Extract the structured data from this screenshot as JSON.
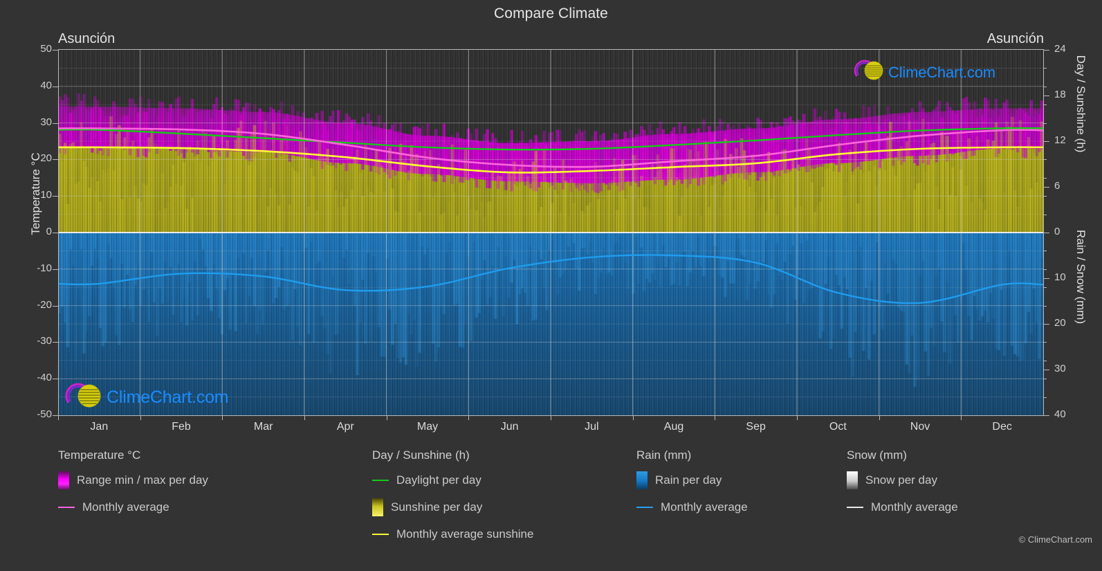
{
  "header": {
    "title": "Compare Climate"
  },
  "locations": {
    "left": "Asunción",
    "right": "Asunción"
  },
  "axes": {
    "left_title": "Temperature °C",
    "right_title_top": "Day / Sunshine (h)",
    "right_title_bottom": "Rain / Snow (mm)",
    "left_ticks": [
      "50",
      "40",
      "30",
      "20",
      "10",
      "0",
      "-10",
      "-20",
      "-30",
      "-40",
      "-50"
    ],
    "right_ticks_top": [
      "24",
      "18",
      "12",
      "6",
      "0"
    ],
    "right_ticks_bottom": [
      "0",
      "10",
      "20",
      "30",
      "40"
    ],
    "x_ticks": [
      "Jan",
      "Feb",
      "Mar",
      "Apr",
      "May",
      "Jun",
      "Jul",
      "Aug",
      "Sep",
      "Oct",
      "Nov",
      "Dec"
    ]
  },
  "logo": {
    "text": "ClimeChart.com",
    "arc_color": "#cc22cc",
    "sphere_color": "#d8d000",
    "text_color": "#1a8cff"
  },
  "legend": {
    "groups": [
      {
        "title": "Temperature °C",
        "items": [
          {
            "label": "Range min / max per day",
            "marker": "swatch",
            "color": "#ee00ee"
          },
          {
            "label": "Monthly average",
            "marker": "line",
            "color": "#ff66dd"
          }
        ]
      },
      {
        "title": "Day / Sunshine (h)",
        "items": [
          {
            "label": "Daylight per day",
            "marker": "line",
            "color": "#18c818"
          },
          {
            "label": "Sunshine per day",
            "marker": "swatch",
            "color": "#f2ef55"
          },
          {
            "label": "Monthly average sunshine",
            "marker": "line",
            "color": "#ffff33"
          }
        ]
      },
      {
        "title": "Rain (mm)",
        "items": [
          {
            "label": "Rain per day",
            "marker": "swatch",
            "color": "#1787d8"
          },
          {
            "label": "Monthly average",
            "marker": "line",
            "color": "#22a0ee"
          }
        ]
      },
      {
        "title": "Snow (mm)",
        "items": [
          {
            "label": "Snow per day",
            "marker": "swatch",
            "color": "#f2f2f2"
          },
          {
            "label": "Monthly average",
            "marker": "line",
            "color": "#e8e8e8"
          }
        ]
      }
    ]
  },
  "footer": {
    "copyright": "© ClimeChart.com"
  },
  "chart_data": {
    "type": "area",
    "title": "Compare Climate",
    "subtitle": "Asunción",
    "xlabel": "",
    "ylabel": "Temperature °C",
    "ylabel_right_top": "Day / Sunshine (h)",
    "ylabel_right_bottom": "Rain / Snow (mm)",
    "ylim": [
      -50,
      50
    ],
    "ylim_right_top": [
      0,
      24
    ],
    "ylim_right_bottom": [
      40,
      0
    ],
    "grid": true,
    "legend_position": "below",
    "categories": [
      "Jan",
      "Feb",
      "Mar",
      "Apr",
      "May",
      "Jun",
      "Jul",
      "Aug",
      "Sep",
      "Oct",
      "Nov",
      "Dec"
    ],
    "series": [
      {
        "name": "Range min / max per day",
        "unit": "°C",
        "type": "band",
        "color": "#ee00ee",
        "max_values": [
          34.5,
          34.0,
          33.0,
          30.0,
          26.5,
          24.5,
          25.0,
          27.0,
          28.5,
          31.0,
          33.0,
          34.0
        ],
        "min_values": [
          23.5,
          23.0,
          22.0,
          19.0,
          16.0,
          14.0,
          13.5,
          14.5,
          16.5,
          19.0,
          21.0,
          23.0
        ]
      },
      {
        "name": "Monthly average temperature",
        "unit": "°C",
        "type": "line",
        "color": "#ff66dd",
        "values": [
          28.5,
          28.2,
          27.0,
          24.0,
          20.5,
          18.5,
          18.0,
          19.5,
          21.0,
          24.0,
          26.5,
          28.0
        ]
      },
      {
        "name": "Daylight per day",
        "unit": "h",
        "type": "line",
        "color": "#18c818",
        "values": [
          13.5,
          13.0,
          12.4,
          11.8,
          11.2,
          10.9,
          11.0,
          11.5,
          12.1,
          12.8,
          13.4,
          13.7
        ]
      },
      {
        "name": "Sunshine per day",
        "unit": "h",
        "type": "band",
        "color": "#f2ef55",
        "values": [
          11.2,
          11.0,
          10.6,
          9.8,
          8.6,
          7.8,
          8.0,
          8.5,
          9.0,
          10.2,
          10.9,
          11.2
        ]
      },
      {
        "name": "Monthly average sunshine",
        "unit": "h",
        "type": "line",
        "color": "#ffff33",
        "values": [
          11.2,
          11.1,
          10.7,
          9.9,
          8.7,
          7.9,
          8.1,
          8.6,
          9.1,
          10.3,
          11.0,
          11.2
        ]
      },
      {
        "name": "Rain per day",
        "unit": "mm",
        "type": "band",
        "color": "#1787d8",
        "values": [
          11.2,
          9.0,
          9.5,
          12.5,
          12.0,
          8.0,
          5.5,
          5.0,
          6.5,
          13.0,
          15.5,
          11.5
        ]
      },
      {
        "name": "Monthly average rain",
        "unit": "mm",
        "type": "line",
        "color": "#22a0ee",
        "values": [
          11.2,
          9.0,
          9.6,
          12.6,
          11.8,
          7.8,
          5.4,
          5.0,
          6.6,
          13.2,
          15.4,
          11.4
        ]
      },
      {
        "name": "Snow per day",
        "unit": "mm",
        "type": "band",
        "color": "#f2f2f2",
        "values": [
          0,
          0,
          0,
          0,
          0,
          0,
          0,
          0,
          0,
          0,
          0,
          0
        ]
      },
      {
        "name": "Monthly average snow",
        "unit": "mm",
        "type": "line",
        "color": "#e8e8e8",
        "values": [
          0,
          0,
          0,
          0,
          0,
          0,
          0,
          0,
          0,
          0,
          0,
          0
        ]
      }
    ]
  }
}
